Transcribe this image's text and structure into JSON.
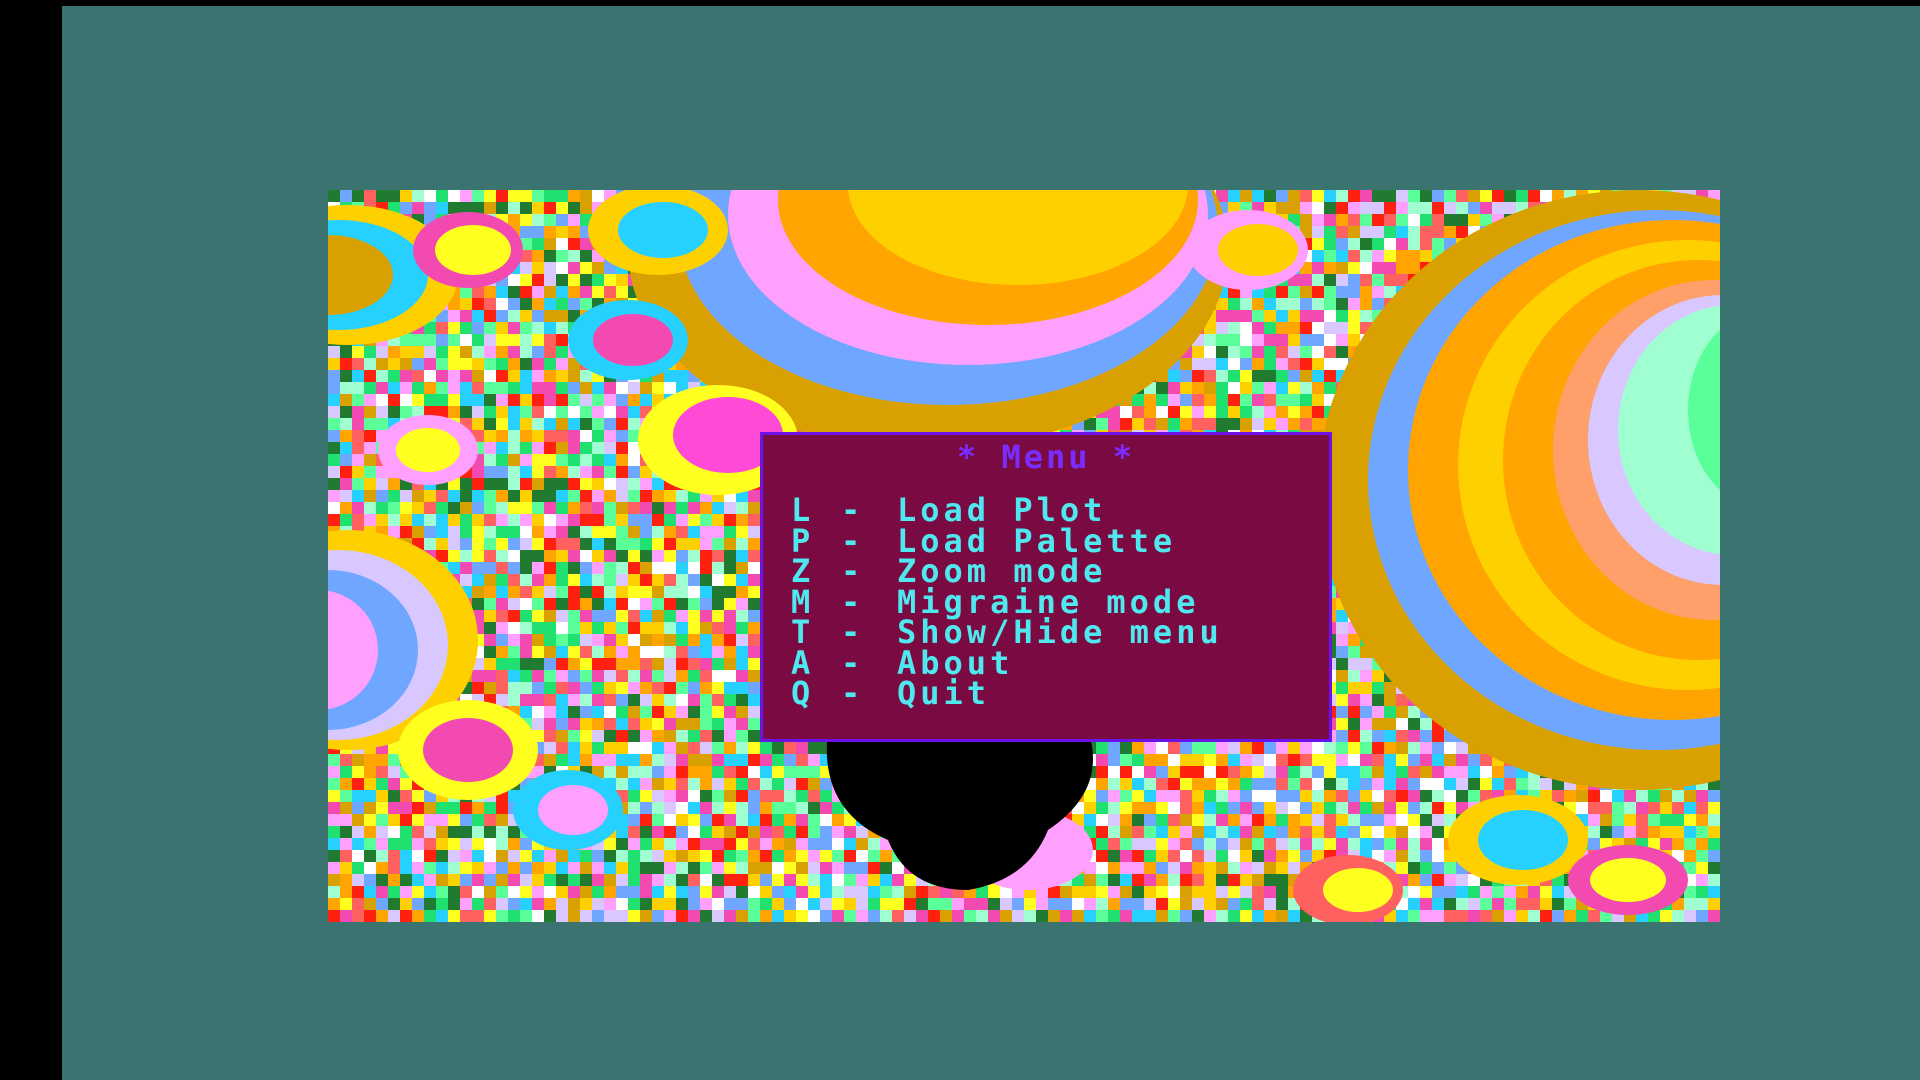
{
  "menu": {
    "title": "* Menu *",
    "items": [
      {
        "key": "L",
        "separator": "-",
        "label": "Load Plot"
      },
      {
        "key": "P",
        "separator": "-",
        "label": "Load Palette"
      },
      {
        "key": "Z",
        "separator": "-",
        "label": "Zoom mode"
      },
      {
        "key": "M",
        "separator": "-",
        "label": "Migraine mode"
      },
      {
        "key": "T",
        "separator": "-",
        "label": "Show/Hide menu"
      },
      {
        "key": "A",
        "separator": "-",
        "label": "About"
      },
      {
        "key": "Q",
        "separator": "-",
        "label": "Quit"
      }
    ]
  },
  "colors": {
    "overscan": "#3b7371",
    "menu_background": "#7a0b42",
    "menu_border": "#6a12e8",
    "menu_title": "#7a2cff",
    "menu_text": "#4fe8ef",
    "set_interior": "#000000"
  },
  "fractal": {
    "palette": [
      "#f24ab0",
      "#ffa400",
      "#ffd000",
      "#ffff20",
      "#6fa6ff",
      "#ffa0ff",
      "#d8c8ff",
      "#d8a000",
      "#26d0ff",
      "#ff2010",
      "#207a30",
      "#ffffff",
      "#5aff9a",
      "#20e070",
      "#a0ffd0",
      "#ff6060"
    ]
  }
}
